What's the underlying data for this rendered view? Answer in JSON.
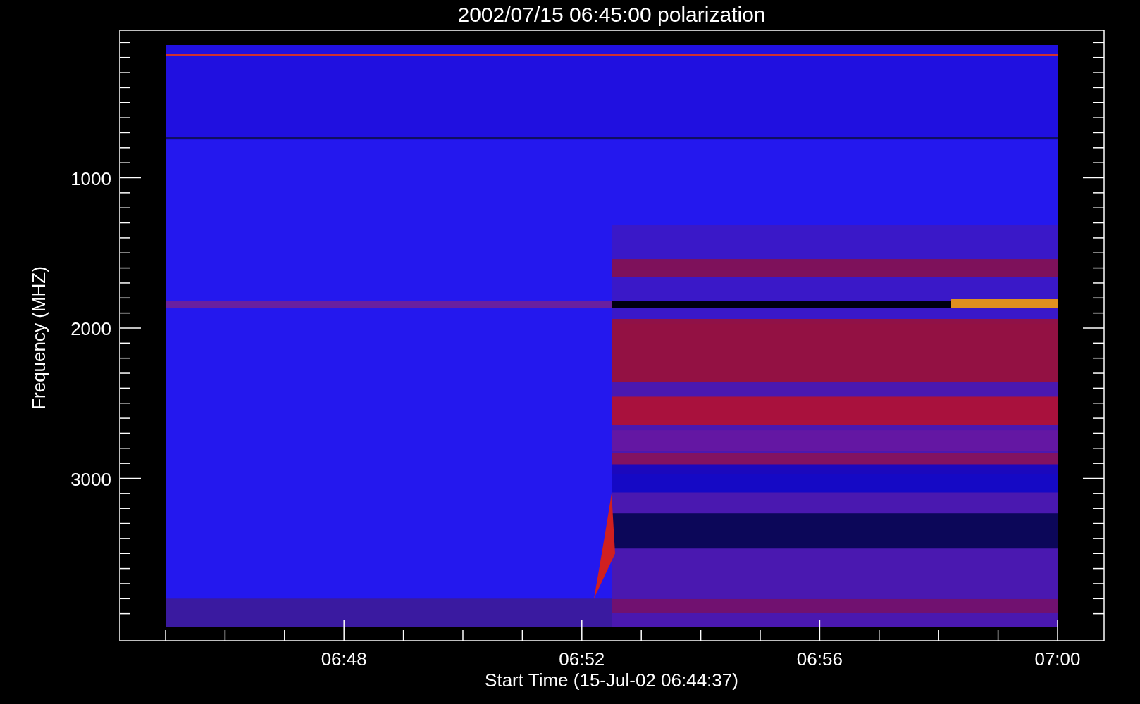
{
  "plot": {
    "title": "2002/07/15 06:45:00 polarization",
    "ylabel": "Frequency (MHZ)",
    "xlabel": "Start Time (15-Jul-02 06:44:37)",
    "y_tick_labels": [
      "1000",
      "2000",
      "3000"
    ],
    "x_tick_labels": [
      "06:48",
      "06:52",
      "06:56",
      "07:00"
    ]
  }
}
